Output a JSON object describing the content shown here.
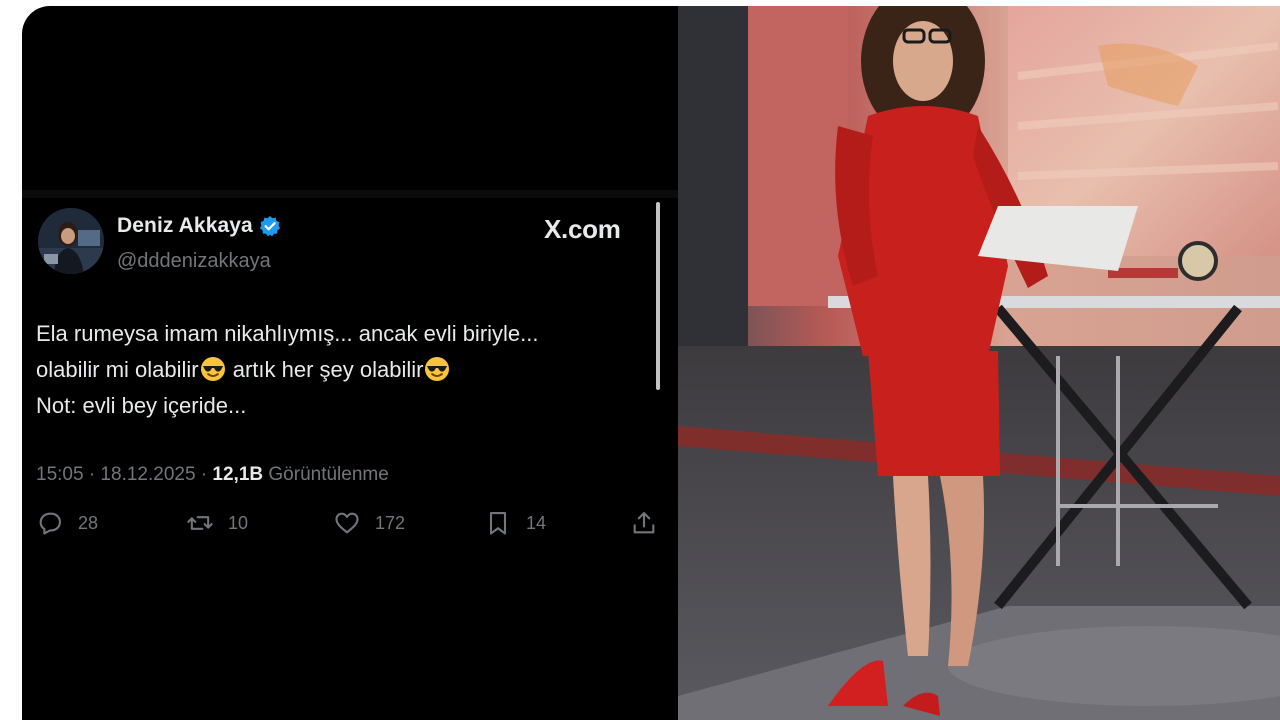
{
  "tweet": {
    "display_name": "Deniz Akkaya",
    "handle": "@dddenizakkaya",
    "source_label": "X.com",
    "body_lines": [
      "Ela rumeysa imam nikahlıymış... ancak evli biriyle...",
      "olabilir mi olabilir",
      " artık her şey olabilir",
      "Not: evli bey içeride..."
    ],
    "timestamp": "15:05 · 18.12.2025 · ",
    "views_count": "12,1B",
    "views_label": " Görüntülenme",
    "actions": {
      "replies": "28",
      "reposts": "10",
      "likes": "172",
      "bookmarks": "14"
    }
  },
  "icons": {
    "verified": "verified-badge-icon",
    "emoji": "sunglasses-emoji",
    "reply": "reply-icon",
    "repost": "repost-icon",
    "like": "heart-icon",
    "bookmark": "bookmark-icon",
    "share": "share-icon"
  },
  "colors": {
    "background": "#000000",
    "text_primary": "#e7e9ea",
    "text_secondary": "#71767b",
    "verified_blue": "#1d9bf0",
    "suit_red": "#c8201c"
  }
}
